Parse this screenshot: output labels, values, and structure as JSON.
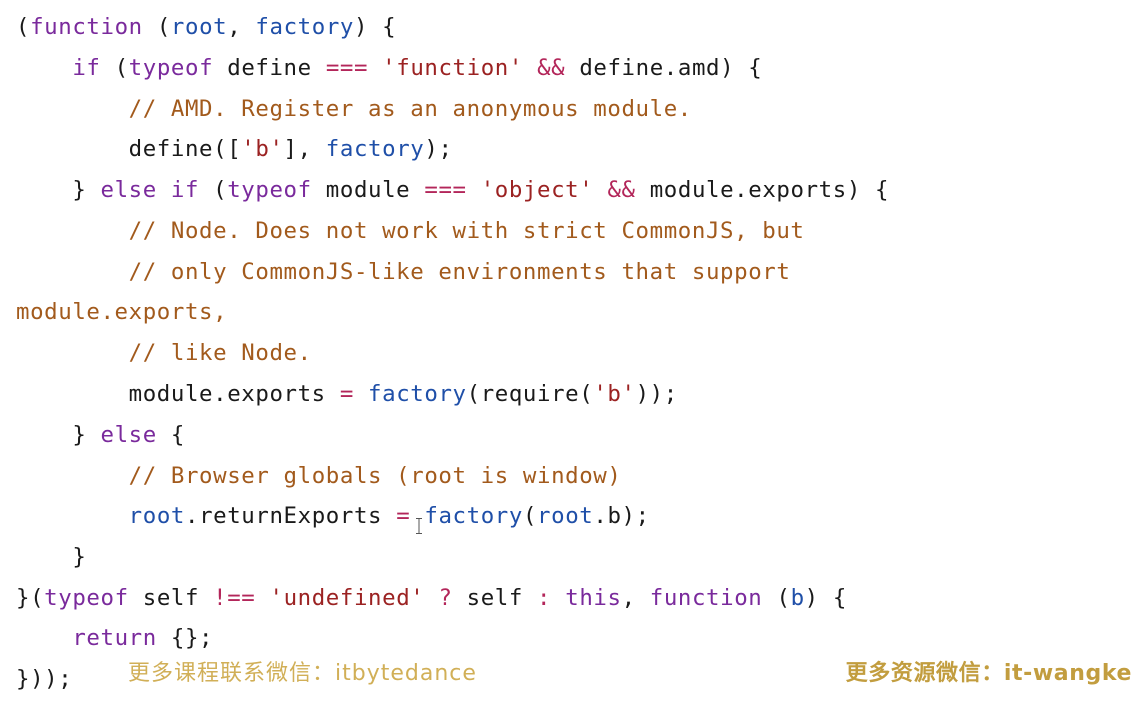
{
  "code": {
    "lines": [
      [
        [
          "pl",
          "("
        ],
        [
          "kw",
          "function"
        ],
        [
          "pl",
          " ("
        ],
        [
          "id",
          "root"
        ],
        [
          "pl",
          ", "
        ],
        [
          "id",
          "factory"
        ],
        [
          "pl",
          ") {"
        ]
      ],
      [
        [
          "pl",
          "    "
        ],
        [
          "kw",
          "if"
        ],
        [
          "pl",
          " ("
        ],
        [
          "kw",
          "typeof"
        ],
        [
          "pl",
          " define "
        ],
        [
          "op",
          "==="
        ],
        [
          "pl",
          " "
        ],
        [
          "str",
          "'function'"
        ],
        [
          "pl",
          " "
        ],
        [
          "op",
          "&&"
        ],
        [
          "pl",
          " define.amd) {"
        ]
      ],
      [
        [
          "pl",
          "        "
        ],
        [
          "cm",
          "// AMD. Register as an anonymous module."
        ]
      ],
      [
        [
          "pl",
          "        define(["
        ],
        [
          "str",
          "'b'"
        ],
        [
          "pl",
          "], "
        ],
        [
          "id",
          "factory"
        ],
        [
          "pl",
          ");"
        ]
      ],
      [
        [
          "pl",
          "    } "
        ],
        [
          "kw",
          "else if"
        ],
        [
          "pl",
          " ("
        ],
        [
          "kw",
          "typeof"
        ],
        [
          "pl",
          " module "
        ],
        [
          "op",
          "==="
        ],
        [
          "pl",
          " "
        ],
        [
          "str",
          "'object'"
        ],
        [
          "pl",
          " "
        ],
        [
          "op",
          "&&"
        ],
        [
          "pl",
          " module.exports) {"
        ]
      ],
      [
        [
          "pl",
          "        "
        ],
        [
          "cm",
          "// Node. Does not work with strict CommonJS, but"
        ]
      ],
      [
        [
          "pl",
          "        "
        ],
        [
          "cm",
          "// only CommonJS-like environments that support"
        ]
      ],
      [
        [
          "cm",
          "module.exports,"
        ]
      ],
      [
        [
          "pl",
          "        "
        ],
        [
          "cm",
          "// like Node."
        ]
      ],
      [
        [
          "pl",
          "        module.exports "
        ],
        [
          "op",
          "="
        ],
        [
          "pl",
          " "
        ],
        [
          "id",
          "factory"
        ],
        [
          "pl",
          "(require("
        ],
        [
          "str",
          "'b'"
        ],
        [
          "pl",
          "));"
        ]
      ],
      [
        [
          "pl",
          "    } "
        ],
        [
          "kw",
          "else"
        ],
        [
          "pl",
          " {"
        ]
      ],
      [
        [
          "pl",
          "        "
        ],
        [
          "cm",
          "// Browser globals (root is window)"
        ]
      ],
      [
        [
          "pl",
          "        "
        ],
        [
          "id",
          "root"
        ],
        [
          "pl",
          ".returnExports "
        ],
        [
          "op",
          "="
        ],
        [
          "pl",
          " "
        ],
        [
          "id",
          "factory"
        ],
        [
          "pl",
          "("
        ],
        [
          "id",
          "root"
        ],
        [
          "pl",
          ".b);"
        ]
      ],
      [
        [
          "pl",
          "    }"
        ]
      ],
      [
        [
          "pl",
          "}("
        ],
        [
          "kw",
          "typeof"
        ],
        [
          "pl",
          " self "
        ],
        [
          "op",
          "!=="
        ],
        [
          "pl",
          " "
        ],
        [
          "str",
          "'undefined'"
        ],
        [
          "pl",
          " "
        ],
        [
          "op",
          "?"
        ],
        [
          "pl",
          " self "
        ],
        [
          "op",
          ":"
        ],
        [
          "pl",
          " "
        ],
        [
          "kw",
          "this"
        ],
        [
          "pl",
          ", "
        ],
        [
          "kw",
          "function"
        ],
        [
          "pl",
          " ("
        ],
        [
          "id",
          "b"
        ],
        [
          "pl",
          ") {"
        ]
      ],
      [
        [
          "pl",
          "    "
        ],
        [
          "kw",
          "return"
        ],
        [
          "pl",
          " {};"
        ]
      ],
      [
        [
          "pl",
          "}));"
        ]
      ]
    ]
  },
  "watermarks": {
    "left": "更多课程联系微信：itbytedance",
    "right": "更多资源微信：it-wangke"
  },
  "colors": {
    "keyword": "#7a2a9c",
    "identifier": "#1f4fa8",
    "string": "#9b2222",
    "comment": "#a25a1c",
    "operator": "#b3265a",
    "plain": "#1a1a1a",
    "watermark": "#c9a23a"
  },
  "icons": {
    "cursor": "text-cursor-icon"
  }
}
